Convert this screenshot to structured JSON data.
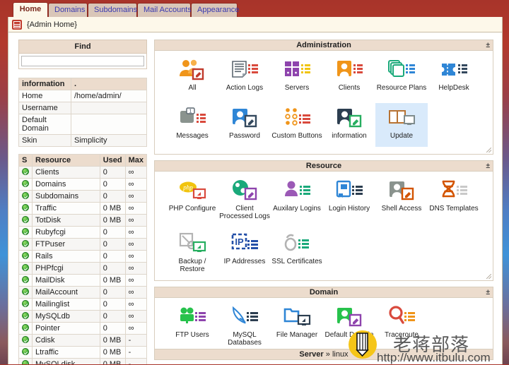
{
  "tabs": [
    {
      "label": "Home",
      "active": true
    },
    {
      "label": "Domains",
      "active": false
    },
    {
      "label": "Subdomains",
      "active": false
    },
    {
      "label": "Mail Accounts",
      "active": false
    },
    {
      "label": "Appearance",
      "active": false
    }
  ],
  "breadcrumb": {
    "icon": "admin-panel-icon",
    "text": "{Admin Home}"
  },
  "find": {
    "title": "Find",
    "value": "",
    "placeholder": ""
  },
  "information": {
    "header_label": "information",
    "header_value": ".",
    "rows": [
      {
        "label": "Home",
        "value": "/home/admin/",
        "link": true
      },
      {
        "label": "Username",
        "value": "",
        "link": false
      },
      {
        "label": "Default Domain",
        "value": "",
        "link": false
      },
      {
        "label": "Skin",
        "value": "Simplicity",
        "link": true
      }
    ]
  },
  "resource_table": {
    "columns": [
      "S",
      "Resource",
      "Used",
      "Max"
    ],
    "rows": [
      {
        "status": "ok",
        "resource": "Clients",
        "used": "0",
        "max": "∞"
      },
      {
        "status": "ok",
        "resource": "Domains",
        "used": "0",
        "max": "∞"
      },
      {
        "status": "ok",
        "resource": "Subdomains",
        "used": "0",
        "max": "∞"
      },
      {
        "status": "ok",
        "resource": "Traffic",
        "used": "0 MB",
        "max": "∞"
      },
      {
        "status": "ok",
        "resource": "TotDisk",
        "used": "0 MB",
        "max": "∞"
      },
      {
        "status": "ok",
        "resource": "Rubyfcgi",
        "used": "0",
        "max": "∞"
      },
      {
        "status": "ok",
        "resource": "FTPuser",
        "used": "0",
        "max": "∞"
      },
      {
        "status": "ok",
        "resource": "Rails",
        "used": "0",
        "max": "∞"
      },
      {
        "status": "ok",
        "resource": "PHPfcgi",
        "used": "0",
        "max": "∞"
      },
      {
        "status": "ok",
        "resource": "MailDisk",
        "used": "0 MB",
        "max": "∞"
      },
      {
        "status": "ok",
        "resource": "MailAccount",
        "used": "0",
        "max": "∞"
      },
      {
        "status": "ok",
        "resource": "Mailinglist",
        "used": "0",
        "max": "∞"
      },
      {
        "status": "ok",
        "resource": "MySQLdb",
        "used": "0",
        "max": "∞"
      },
      {
        "status": "ok",
        "resource": "Pointer",
        "used": "0",
        "max": "∞"
      },
      {
        "status": "ok",
        "resource": "Cdisk",
        "used": "0 MB",
        "max": "-"
      },
      {
        "status": "ok",
        "resource": "Ltraffic",
        "used": "0 MB",
        "max": "-"
      },
      {
        "status": "ok",
        "resource": "MySQLdisk",
        "used": "0 MB",
        "max": "-"
      }
    ]
  },
  "panels": [
    {
      "title": "Administration",
      "collapse_glyph": "±",
      "items": [
        {
          "label": "All",
          "icon": "users-edit-icon",
          "selected": false
        },
        {
          "label": "Action Logs",
          "icon": "document-list-icon",
          "selected": false
        },
        {
          "label": "Servers",
          "icon": "servers-icon",
          "selected": false
        },
        {
          "label": "Clients",
          "icon": "client-user-icon",
          "selected": false
        },
        {
          "label": "Resource Plans",
          "icon": "stacked-pages-icon",
          "selected": false
        },
        {
          "label": "HelpDesk",
          "icon": "ticket-icon",
          "selected": false
        },
        {
          "label": "Messages",
          "icon": "message-badge-icon",
          "selected": false
        },
        {
          "label": "Password",
          "icon": "user-edit-icon",
          "selected": false
        },
        {
          "label": "Custom Buttons",
          "icon": "dots-grid-icon",
          "selected": false
        },
        {
          "label": "information",
          "icon": "user-info-icon",
          "selected": false
        },
        {
          "label": "Update",
          "icon": "book-monitor-icon",
          "selected": true
        }
      ]
    },
    {
      "title": "Resource",
      "collapse_glyph": "±",
      "items": [
        {
          "label": "PHP Configure",
          "icon": "php-monitor-icon",
          "selected": false
        },
        {
          "label": "Client Processed Logs",
          "icon": "globe-edit-icon",
          "selected": false
        },
        {
          "label": "Auxilary Logins",
          "icon": "person-list-icon",
          "selected": false
        },
        {
          "label": "Login History",
          "icon": "book-list-icon",
          "selected": false
        },
        {
          "label": "Shell Access",
          "icon": "user-shell-icon",
          "selected": false
        },
        {
          "label": "DNS Templates",
          "icon": "dna-icon",
          "selected": false
        },
        {
          "label": "Backup / Restore",
          "icon": "backup-monitor-icon",
          "selected": false
        },
        {
          "label": "IP Addresses",
          "icon": "ip-address-icon",
          "selected": false
        },
        {
          "label": "SSL Certificates",
          "icon": "lock-ssl-icon",
          "selected": false
        }
      ]
    },
    {
      "title": "Domain",
      "collapse_glyph": "±",
      "items": [
        {
          "label": "FTP Users",
          "icon": "ftp-users-icon",
          "selected": false
        },
        {
          "label": "MySQL Databases",
          "icon": "mysql-dolphin-icon",
          "selected": false
        },
        {
          "label": "File Manager",
          "icon": "folder-monitor-icon",
          "selected": false
        },
        {
          "label": "Default Domain",
          "icon": "domain-user-icon",
          "selected": false
        },
        {
          "label": "Traceroute",
          "icon": "search-list-icon",
          "selected": false
        }
      ]
    }
  ],
  "server_bar": {
    "prefix": "Server",
    "sep": "»",
    "value": "linux"
  },
  "watermark": {
    "cn": "老蒋部落",
    "url": "http://www.itbulu.com"
  },
  "colors": {
    "accent_orange": "#f39c12",
    "panel_header": "#ecdccd",
    "selected_blue": "#d9eafb",
    "tab_active_bg": "#fdf8ea",
    "link_blue": "#3a3ab0"
  }
}
